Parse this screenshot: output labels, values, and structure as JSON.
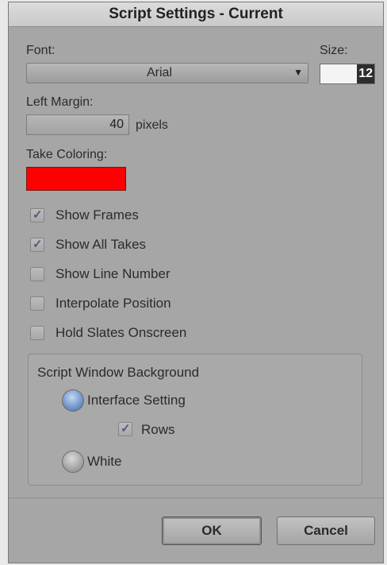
{
  "dialog": {
    "title": "Script Settings - Current"
  },
  "font": {
    "label": "Font:",
    "value": "Arial"
  },
  "size": {
    "label": "Size:",
    "value": "12"
  },
  "left_margin": {
    "label": "Left Margin:",
    "value": "40",
    "unit": "pixels"
  },
  "take_coloring": {
    "label": "Take Coloring:",
    "color": "#ff0000"
  },
  "checkboxes": [
    {
      "label": "Show Frames",
      "checked": true
    },
    {
      "label": "Show All Takes",
      "checked": true
    },
    {
      "label": "Show Line Number",
      "checked": false
    },
    {
      "label": "Interpolate Position",
      "checked": false
    },
    {
      "label": "Hold Slates Onscreen",
      "checked": false
    }
  ],
  "background_group": {
    "title": "Script Window Background",
    "option_interface": {
      "label": "Interface Setting",
      "selected": true
    },
    "rows": {
      "label": "Rows",
      "checked": true
    },
    "option_white": {
      "label": "White",
      "selected": false
    }
  },
  "buttons": {
    "ok": "OK",
    "cancel": "Cancel"
  },
  "icons": {
    "dropdown": "chevron-down-icon",
    "check": "checkmark-icon"
  }
}
